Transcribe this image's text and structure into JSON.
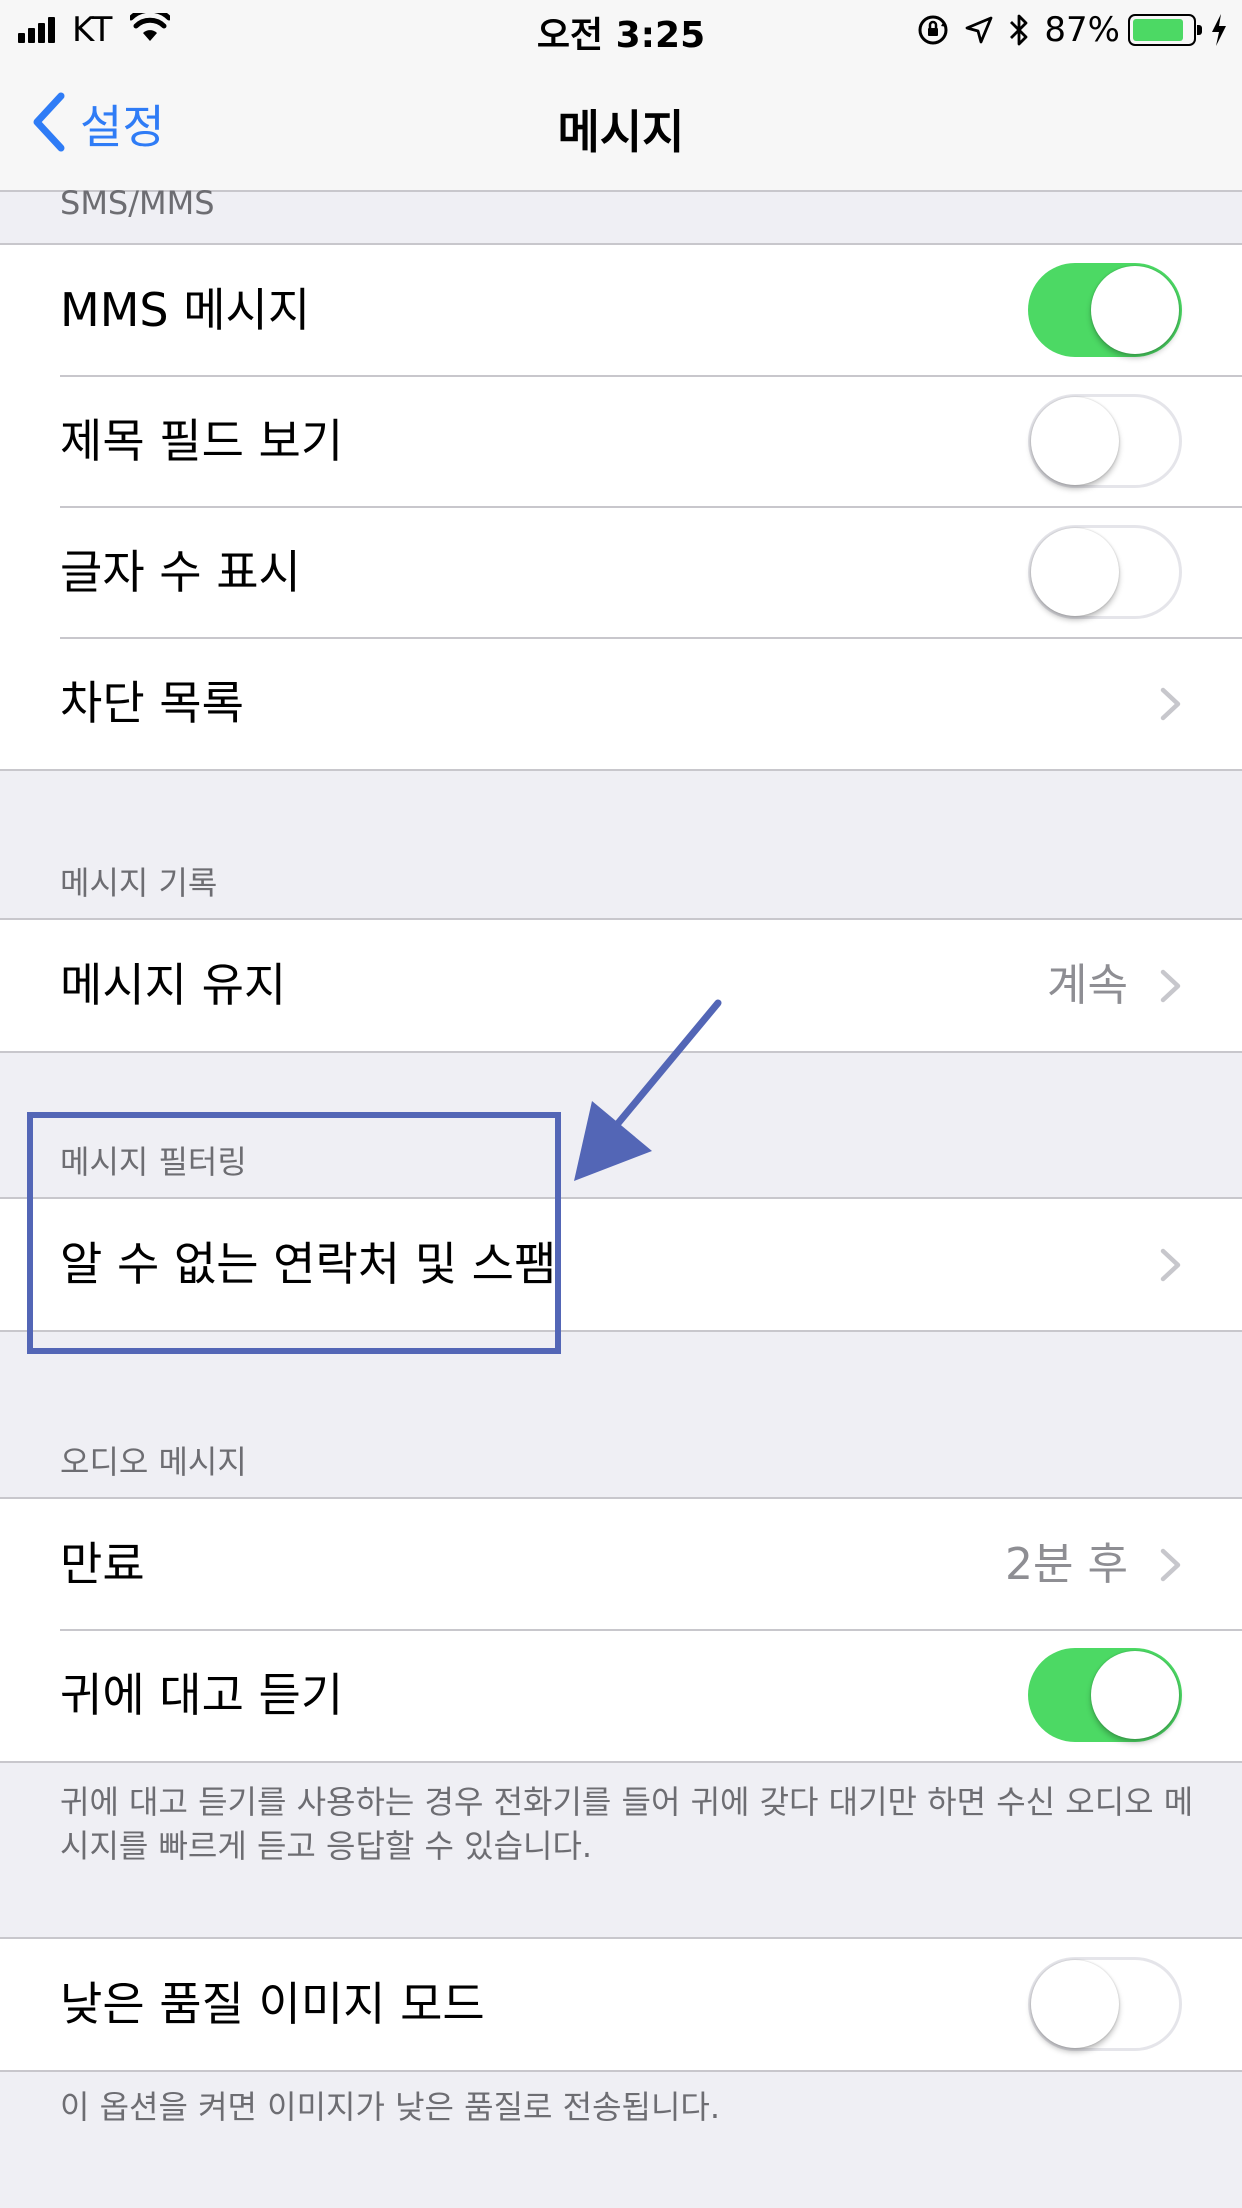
{
  "status_bar": {
    "carrier": "KT",
    "time": "오전 3:25",
    "battery_percent": "87%",
    "battery_level": 0.87,
    "battery_color": "#4cd964",
    "icons": [
      "signal-bars-icon",
      "wifi-icon",
      "orientation-lock-icon",
      "location-arrow-icon",
      "bluetooth-icon",
      "battery-icon",
      "charging-bolt-icon"
    ]
  },
  "nav": {
    "back_label": "설정",
    "title": "메시지",
    "accent_color": "#2f7cf6"
  },
  "sections": {
    "sms_mms": {
      "header": "SMS/MMS",
      "rows": {
        "mms": {
          "label": "MMS 메시지",
          "toggle": true
        },
        "subject": {
          "label": "제목 필드 보기",
          "toggle": false
        },
        "char_count": {
          "label": "글자 수 표시",
          "toggle": false
        },
        "blocked": {
          "label": "차단 목록"
        }
      }
    },
    "history": {
      "header": "메시지 기록",
      "rows": {
        "keep": {
          "label": "메시지 유지",
          "value": "계속"
        }
      }
    },
    "filtering": {
      "header": "메시지 필터링",
      "rows": {
        "unknown": {
          "label": "알 수 없는 연락처 및 스팸"
        }
      }
    },
    "audio": {
      "header": "오디오 메시지",
      "rows": {
        "expire": {
          "label": "만료",
          "value": "2분 후"
        },
        "raise": {
          "label": "귀에 대고 듣기",
          "toggle": true
        }
      },
      "footer": "귀에 대고 듣기를 사용하는 경우 전화기를 들어 귀에 갖다 대기만 하면 수신 오디오 메시지를 빠르게 듣고 응답할 수 있습니다."
    },
    "low_quality": {
      "rows": {
        "mode": {
          "label": "낮은 품질 이미지 모드",
          "toggle": false
        }
      },
      "footer": "이 옵션을 켜면 이미지가 낮은 품질로 전송됩니다."
    }
  },
  "annotation": {
    "color": "#5366b6"
  }
}
